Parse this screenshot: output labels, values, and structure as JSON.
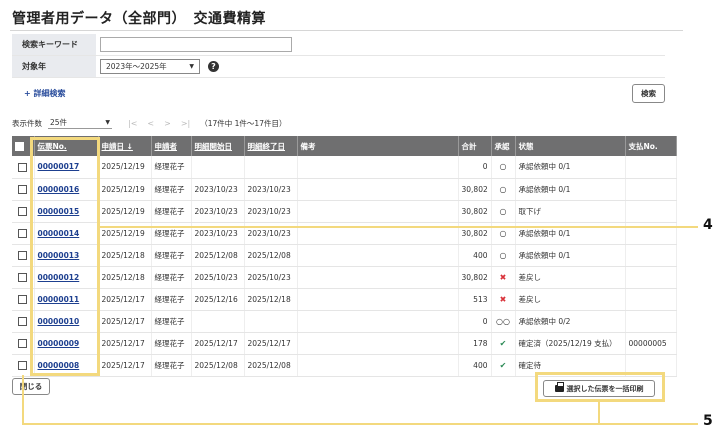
{
  "header": {
    "title": "管理者用データ（全部門）　交通費精算"
  },
  "search_form": {
    "keyword_label": "検索キーワード",
    "keyword_value": "",
    "period_label": "対象年",
    "period_value": "2023年～2025年",
    "help_icon": "?",
    "detail_link": "+ 詳細検索",
    "search_button": "検索"
  },
  "pager": {
    "label": "表示件数",
    "page_size": "25件",
    "nav_glyphs": [
      "|<",
      "<",
      ">",
      ">|"
    ],
    "summary": "（17件中 1件～17件目）"
  },
  "table": {
    "headers": [
      "伝票No.",
      "申請日 ↓",
      "申請者",
      "明細開始日",
      "明細終了日",
      "備考",
      "合計",
      "承認",
      "状態",
      "支払No."
    ],
    "rows": [
      {
        "slip": "00000017",
        "date": "2025/12/19",
        "applicant": "経理花子",
        "start": "",
        "end": "",
        "note": "",
        "total": "0",
        "approval": "○",
        "approval_type": "pending",
        "status": "承認依頼中 0/1",
        "payment": ""
      },
      {
        "slip": "00000016",
        "date": "2025/12/19",
        "applicant": "経理花子",
        "start": "2023/10/23",
        "end": "2023/10/23",
        "note": "",
        "total": "30,802",
        "approval": "○",
        "approval_type": "pending",
        "status": "承認依頼中 0/1",
        "payment": ""
      },
      {
        "slip": "00000015",
        "date": "2025/12/19",
        "applicant": "経理花子",
        "start": "2023/10/23",
        "end": "2023/10/23",
        "note": "",
        "total": "30,802",
        "approval": "○",
        "approval_type": "pending",
        "status": "取下げ",
        "payment": ""
      },
      {
        "slip": "00000014",
        "date": "2025/12/19",
        "applicant": "経理花子",
        "start": "2023/10/23",
        "end": "2023/10/23",
        "note": "",
        "total": "30,802",
        "approval": "○",
        "approval_type": "pending",
        "status": "承認依頼中 0/1",
        "payment": ""
      },
      {
        "slip": "00000013",
        "date": "2025/12/18",
        "applicant": "経理花子",
        "start": "2025/12/08",
        "end": "2025/12/08",
        "note": "",
        "total": "400",
        "approval": "○",
        "approval_type": "pending",
        "status": "承認依頼中 0/1",
        "payment": ""
      },
      {
        "slip": "00000012",
        "date": "2025/12/18",
        "applicant": "経理花子",
        "start": "2025/10/23",
        "end": "2025/10/23",
        "note": "",
        "total": "30,802",
        "approval": "✖",
        "approval_type": "rejected",
        "status": "差戻し",
        "payment": ""
      },
      {
        "slip": "00000011",
        "date": "2025/12/17",
        "applicant": "経理花子",
        "start": "2025/12/16",
        "end": "2025/12/18",
        "note": "",
        "total": "513",
        "approval": "✖",
        "approval_type": "rejected",
        "status": "差戻し",
        "payment": ""
      },
      {
        "slip": "00000010",
        "date": "2025/12/17",
        "applicant": "経理花子",
        "start": "",
        "end": "",
        "note": "",
        "total": "0",
        "approval": "○○",
        "approval_type": "pending",
        "status": "承認依頼中 0/2",
        "payment": ""
      },
      {
        "slip": "00000009",
        "date": "2025/12/17",
        "applicant": "経理花子",
        "start": "2025/12/17",
        "end": "2025/12/17",
        "note": "",
        "total": "178",
        "approval": "✔",
        "approval_type": "done",
        "status": "確定済（2025/12/19 支払）",
        "payment": "00000005"
      },
      {
        "slip": "00000008",
        "date": "2025/12/17",
        "applicant": "経理花子",
        "start": "2025/12/08",
        "end": "2025/12/08",
        "note": "",
        "total": "400",
        "approval": "✔",
        "approval_type": "done",
        "status": "確定待",
        "payment": ""
      }
    ]
  },
  "footer": {
    "close_button": "閉じる",
    "print_button": "選択した伝票を一括印刷"
  },
  "annotations": {
    "callout_a": "4",
    "callout_b": "5"
  },
  "colors": {
    "header_bg": "#6f6f70",
    "label_bg": "#e9ebef",
    "link": "#1d3f8f",
    "highlight": "#f3d97e",
    "rejected": "#d9323a",
    "done": "#2e8b57"
  }
}
